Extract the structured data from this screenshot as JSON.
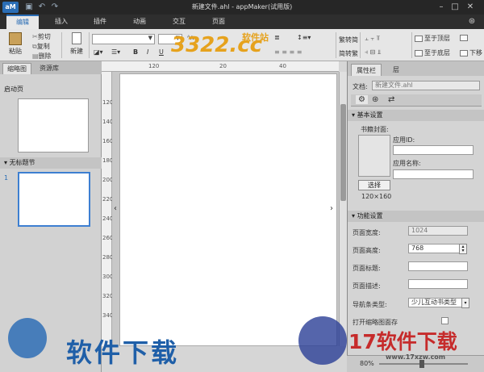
{
  "window": {
    "logo": "aM",
    "title": "新建文件.ahl - appMaker(试用版)"
  },
  "menu_tabs": [
    {
      "label": "编辑"
    },
    {
      "label": "插入"
    },
    {
      "label": "插件"
    },
    {
      "label": "动画"
    },
    {
      "label": "交互"
    },
    {
      "label": "页面"
    }
  ],
  "ribbon": {
    "paste": "粘贴",
    "cut": "剪切",
    "copy": "复制",
    "delete": "删除",
    "new": "新建",
    "sim_to_trad": "繁转简",
    "trad_to_sim": "简转繁",
    "bring_front": "至于顶层",
    "send_back": "至于底层",
    "next_layer": "下移"
  },
  "left_panel": {
    "tabs": [
      "缩略图",
      "资源库"
    ],
    "start_page": "启动页",
    "section": "无标题节",
    "page_number": "1"
  },
  "ruler": {
    "h_ticks": [
      "120",
      "20",
      "40"
    ],
    "v_ticks": [
      "120",
      "140",
      "160",
      "180",
      "200",
      "220",
      "240",
      "260",
      "280",
      "300",
      "320",
      "340"
    ]
  },
  "right_panel": {
    "tabs": [
      "属性栏",
      "层"
    ],
    "doc_label": "文档:",
    "doc_value": "新建文件.ahl",
    "basic_section": "基本设置",
    "cover_label": "书籍封面:",
    "app_id_label": "应用ID:",
    "app_name_label": "应用名称:",
    "choose_button": "选择",
    "cover_size": "120×160",
    "func_section": "功能设置",
    "width_label": "页面宽度:",
    "width_value": "1024",
    "height_label": "页面高度:",
    "height_value": "768",
    "title_label": "页面标题:",
    "desc_label": "页面描述:",
    "nav_label": "导航条类型:",
    "nav_value": "少儿互动书类型",
    "thumb_label": "打开缩略图面存"
  },
  "status": {
    "zoom": "80%"
  },
  "watermarks": {
    "top": "3322.cc",
    "top_sub": "软件站",
    "bottom_left": "软件下载",
    "bottom_right": "17软件下载",
    "bottom_right_sub": "www.17xzw.com"
  }
}
